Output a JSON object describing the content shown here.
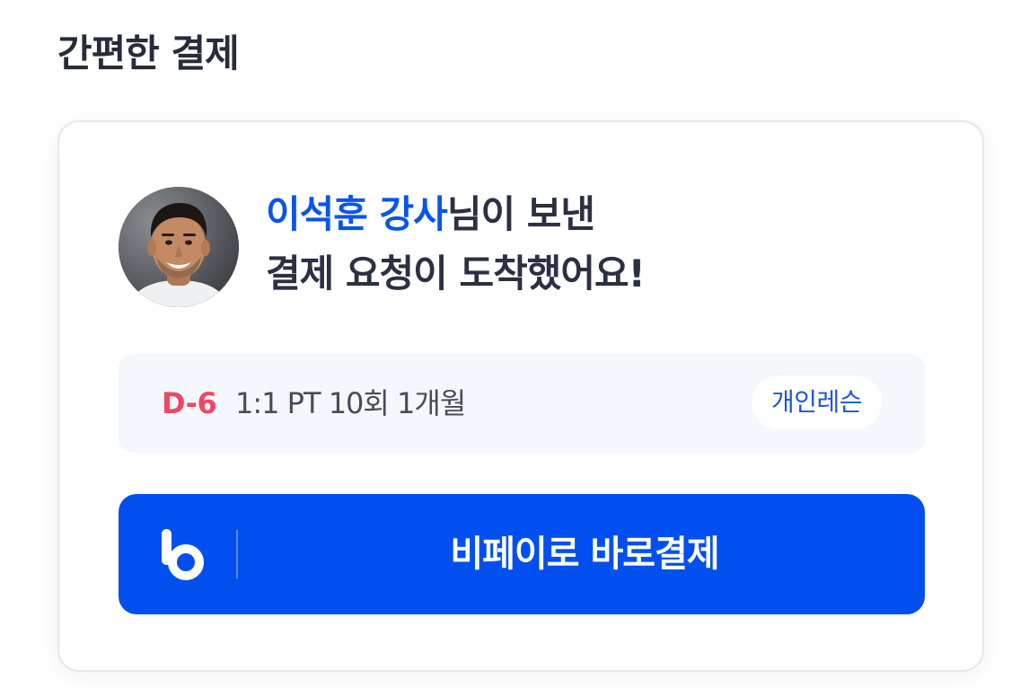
{
  "section": {
    "title": "간편한 결제"
  },
  "request": {
    "sender": "이석훈 강사",
    "line1_suffix": "님이 보낸",
    "line2": "결제 요청이 도착했어요!"
  },
  "lesson": {
    "dday": "D-6",
    "name": "1:1 PT 10회 1개월",
    "tag": "개인레슨"
  },
  "pay_button": {
    "label": "비페이로 바로결제",
    "icon": "bpay-logo-icon"
  },
  "colors": {
    "accent": "#024ff0",
    "highlight_text": "#0a55ea",
    "dday": "#f04763",
    "lesson_bg": "#f4f7fc",
    "title_text": "#272c3a"
  }
}
